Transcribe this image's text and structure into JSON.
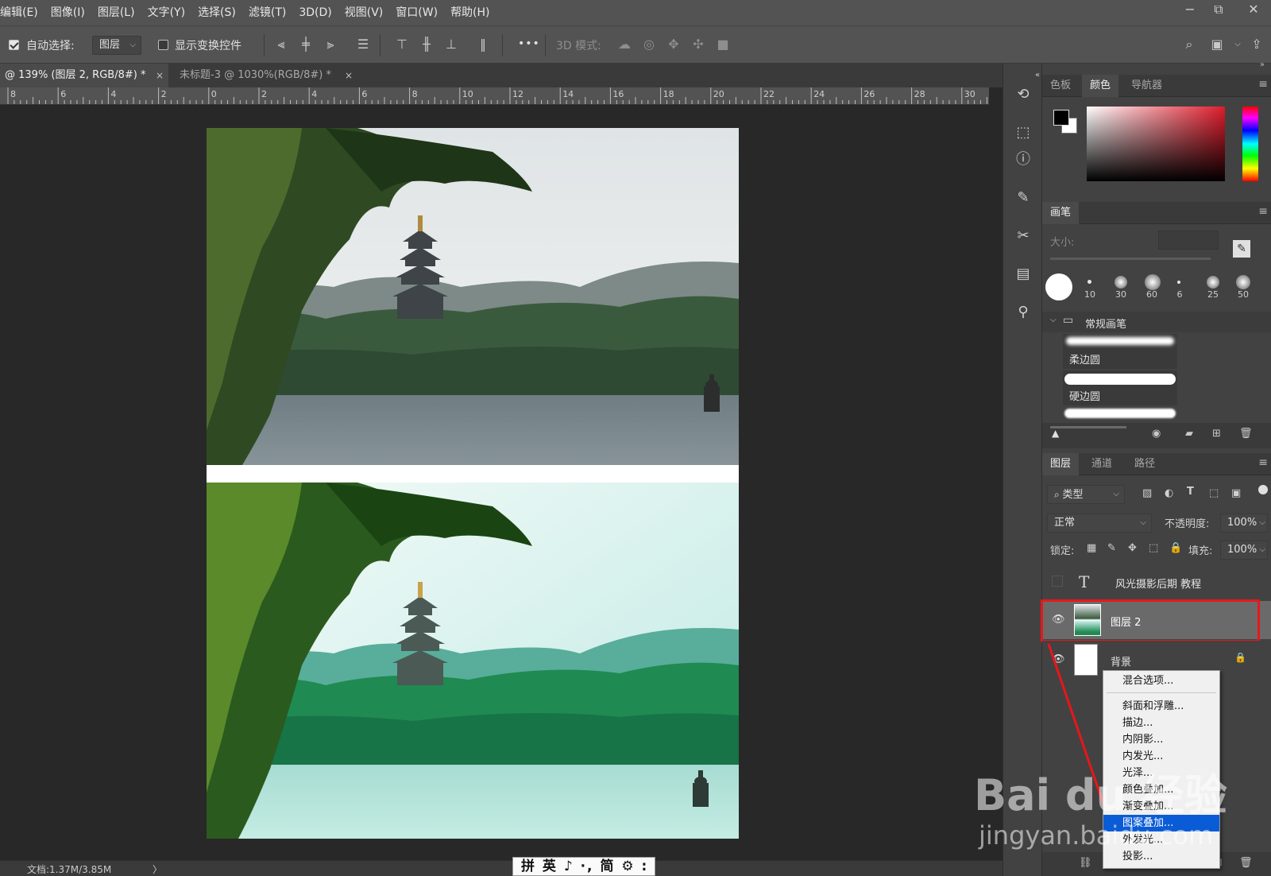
{
  "menu": {
    "items": [
      "编辑(E)",
      "图像(I)",
      "图层(L)",
      "文字(Y)",
      "选择(S)",
      "滤镜(T)",
      "3D(D)",
      "视图(V)",
      "窗口(W)",
      "帮助(H)"
    ]
  },
  "window_controls": {
    "minimize": "−",
    "restore": "⧉",
    "close": "✕"
  },
  "options_bar": {
    "auto_select_label": "自动选择:",
    "auto_select_checked": true,
    "auto_select_target": "图层",
    "show_transform_label": "显示变换控件",
    "show_transform_checked": false,
    "more_label": "•••",
    "mode_3d_label": "3D 模式:"
  },
  "tabs": [
    {
      "label": "@ 139% (图层 2, RGB/8#) *",
      "active": true,
      "close": "×"
    },
    {
      "label": "未标题-3 @ 1030%(RGB/8#) *",
      "active": false,
      "close": "×"
    }
  ],
  "ruler": {
    "labels": [
      "8",
      "6",
      "4",
      "2",
      "0",
      "2",
      "4",
      "6",
      "8",
      "10",
      "12",
      "14",
      "16",
      "18",
      "20",
      "22",
      "24",
      "26",
      "28",
      "30"
    ]
  },
  "status": {
    "doc_size": "文档:1.37M/3.85M",
    "arrow": "〉"
  },
  "ime": {
    "text": "拼 英 ♪ ·, 简 ⚙ :"
  },
  "color_panel": {
    "tabs": [
      "色板",
      "颜色",
      "导航器"
    ],
    "active": "颜色",
    "foreground": "#000000",
    "background": "#ffffff",
    "hue": "#e01c2c"
  },
  "brush_panel": {
    "title": "画笔",
    "size_label": "大小:",
    "presets": [
      {
        "size": "10"
      },
      {
        "size": "30"
      },
      {
        "size": "60"
      },
      {
        "size": "6"
      },
      {
        "size": "25"
      },
      {
        "size": "50"
      }
    ],
    "group_label": "常规画笔",
    "brushes": [
      "柔边圆",
      "硬边圆"
    ]
  },
  "layers_panel": {
    "tabs": [
      "图层",
      "通道",
      "路径"
    ],
    "active": "图层",
    "filter_label": "类型",
    "blend_mode": "正常",
    "opacity_label": "不透明度:",
    "opacity_value": "100%",
    "lock_label": "锁定:",
    "fill_label": "填充:",
    "fill_value": "100%",
    "layers": [
      {
        "name": "风光摄影后期 教程",
        "type": "text",
        "visible": false,
        "thumb_glyph": "T"
      },
      {
        "name": "图层 2",
        "type": "image",
        "visible": true,
        "selected": true
      },
      {
        "name": "背景",
        "type": "fill",
        "visible": true,
        "locked": true
      }
    ]
  },
  "context_menu": {
    "items": [
      "混合选项...",
      "斜面和浮雕...",
      "描边...",
      "内阴影...",
      "内发光...",
      "光泽...",
      "颜色叠加...",
      "渐变叠加...",
      "图案叠加...",
      "外发光...",
      "投影..."
    ],
    "highlighted": "图案叠加..."
  },
  "watermark": {
    "logo": "Bai du 经验",
    "url": "jingyan.baidu.com"
  },
  "highlight_color": "#e8161b"
}
